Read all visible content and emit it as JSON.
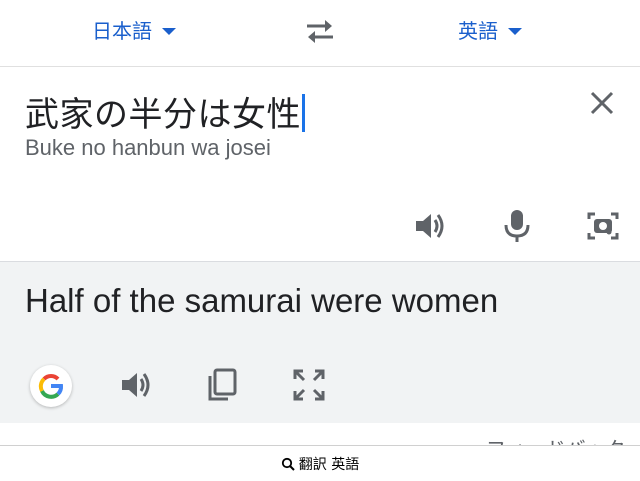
{
  "language_bar": {
    "source_language": "日本語",
    "target_language": "英語"
  },
  "input": {
    "source_text": "武家の半分は女性",
    "romanization": "Buke no hanbun wa josei"
  },
  "output": {
    "translation": "Half of the samurai were women"
  },
  "feedback_label": "フィードバック",
  "search_bar": {
    "label": "翻訳 英語"
  },
  "colors": {
    "accent": "#1a5fcc",
    "icon": "#5f6368",
    "output_bg": "#f1f3f4"
  },
  "icons": [
    "swap-arrows-icon",
    "close-icon",
    "speaker-icon",
    "microphone-icon",
    "camera-lens-icon",
    "google-logo-icon",
    "copy-icon",
    "fullscreen-icon",
    "search-icon"
  ]
}
